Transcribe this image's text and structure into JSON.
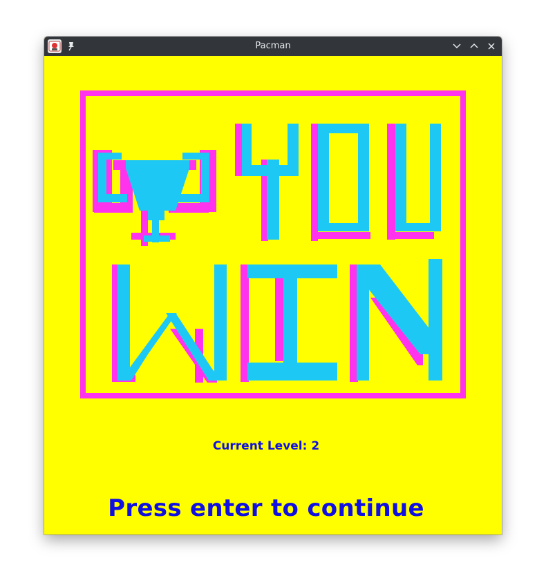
{
  "window": {
    "title": "Pacman"
  },
  "icons": {
    "app": "java-app-icon",
    "pin": "pin-icon",
    "minimize": "chevron-down-icon",
    "maximize": "chevron-up-icon",
    "close": "close-icon"
  },
  "banner": {
    "line1": "YOU",
    "line2": "WIN",
    "trophy": "trophy-icon"
  },
  "game": {
    "level_text": "Current Level: 2",
    "prompt": "Press enter to continue"
  },
  "colors": {
    "background": "#ffff00",
    "art_fill": "#1ec8f5",
    "art_shadow": "#ff33ee",
    "text": "#1010e0",
    "titlebar": "#32363b"
  }
}
